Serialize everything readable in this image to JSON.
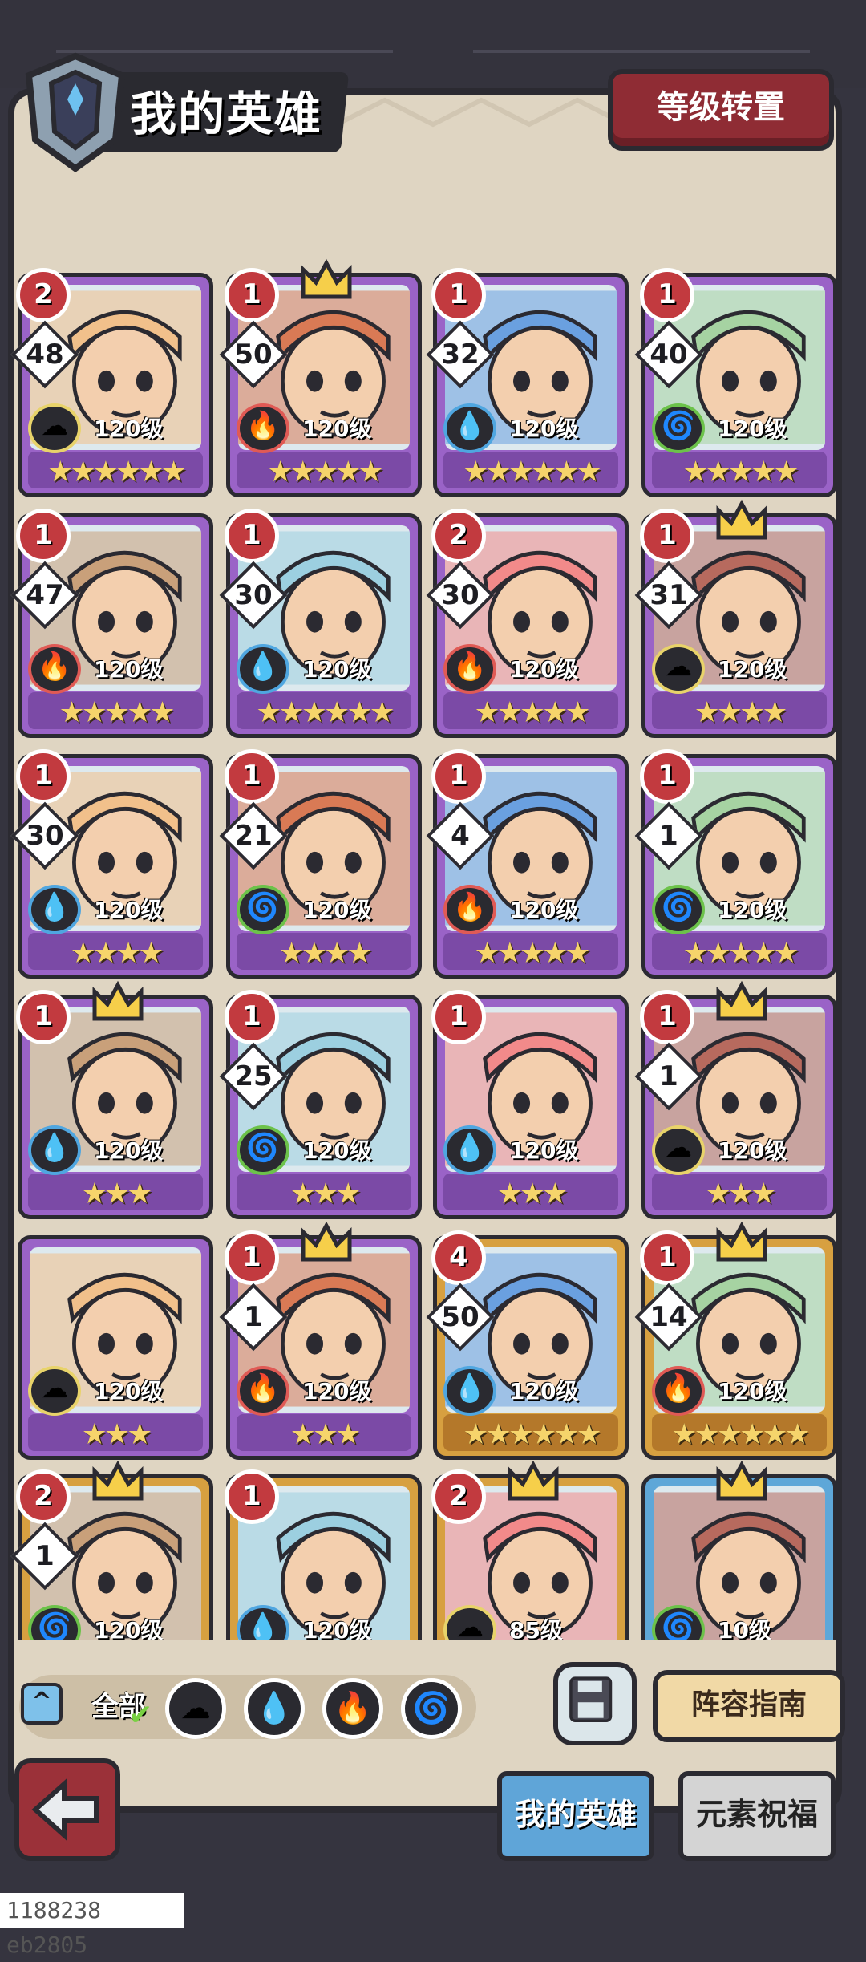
{
  "header": {
    "title": "我的英雄",
    "level_transfer_label": "等级转置"
  },
  "heroes": [
    {
      "rank": "2",
      "level_badge": "48",
      "level": "120级",
      "element": "earth",
      "stars": "★★★★★★",
      "frame": "purple",
      "crown": false
    },
    {
      "rank": "1",
      "level_badge": "50",
      "level": "120级",
      "element": "fire",
      "stars": "★★★★★",
      "frame": "purple",
      "crown": true
    },
    {
      "rank": "1",
      "level_badge": "32",
      "level": "120级",
      "element": "water",
      "stars": "★★★★★★",
      "frame": "purple",
      "crown": false
    },
    {
      "rank": "1",
      "level_badge": "40",
      "level": "120级",
      "element": "wind",
      "stars": "★★★★★",
      "frame": "purple",
      "crown": false
    },
    {
      "rank": "1",
      "level_badge": "47",
      "level": "120级",
      "element": "fire",
      "stars": "★★★★★",
      "frame": "purple",
      "crown": false
    },
    {
      "rank": "1",
      "level_badge": "30",
      "level": "120级",
      "element": "water",
      "stars": "★★★★★★",
      "frame": "purple",
      "crown": false
    },
    {
      "rank": "2",
      "level_badge": "30",
      "level": "120级",
      "element": "fire",
      "stars": "★★★★★",
      "frame": "purple",
      "crown": false
    },
    {
      "rank": "1",
      "level_badge": "31",
      "level": "120级",
      "element": "earth",
      "stars": "★★★★",
      "frame": "purple",
      "crown": true
    },
    {
      "rank": "1",
      "level_badge": "30",
      "level": "120级",
      "element": "water",
      "stars": "★★★★",
      "frame": "purple",
      "crown": false
    },
    {
      "rank": "1",
      "level_badge": "21",
      "level": "120级",
      "element": "wind",
      "stars": "★★★★",
      "frame": "purple",
      "crown": false
    },
    {
      "rank": "1",
      "level_badge": "4",
      "level": "120级",
      "element": "fire",
      "stars": "★★★★★",
      "frame": "purple",
      "crown": false
    },
    {
      "rank": "1",
      "level_badge": "1",
      "level": "120级",
      "element": "wind",
      "stars": "★★★★★",
      "frame": "purple",
      "crown": false
    },
    {
      "rank": "1",
      "level_badge": "",
      "level": "120级",
      "element": "water",
      "stars": "★★★",
      "frame": "purple",
      "crown": true
    },
    {
      "rank": "1",
      "level_badge": "25",
      "level": "120级",
      "element": "wind",
      "stars": "★★★",
      "frame": "purple",
      "crown": false
    },
    {
      "rank": "1",
      "level_badge": "",
      "level": "120级",
      "element": "water",
      "stars": "★★★",
      "frame": "purple",
      "crown": false
    },
    {
      "rank": "1",
      "level_badge": "1",
      "level": "120级",
      "element": "earth",
      "stars": "★★★",
      "frame": "purple",
      "crown": true
    },
    {
      "rank": "",
      "level_badge": "",
      "level": "120级",
      "element": "earth",
      "stars": "★★★",
      "frame": "purple",
      "crown": false
    },
    {
      "rank": "1",
      "level_badge": "1",
      "level": "120级",
      "element": "fire",
      "stars": "★★★",
      "frame": "purple",
      "crown": true
    },
    {
      "rank": "4",
      "level_badge": "50",
      "level": "120级",
      "element": "water",
      "stars": "★★★★★★",
      "frame": "gold",
      "crown": false
    },
    {
      "rank": "1",
      "level_badge": "14",
      "level": "120级",
      "element": "fire",
      "stars": "★★★★★★",
      "frame": "gold",
      "crown": true
    },
    {
      "rank": "2",
      "level_badge": "1",
      "level": "120级",
      "element": "wind",
      "stars": "",
      "frame": "gold",
      "crown": true
    },
    {
      "rank": "1",
      "level_badge": "",
      "level": "120级",
      "element": "water",
      "stars": "",
      "frame": "gold",
      "crown": false
    },
    {
      "rank": "2",
      "level_badge": "",
      "level": "85级",
      "element": "earth",
      "stars": "",
      "frame": "gold",
      "crown": true
    },
    {
      "rank": "",
      "level_badge": "",
      "level": "10级",
      "element": "wind",
      "stars": "",
      "frame": "blue",
      "crown": true
    }
  ],
  "filters": {
    "expand_symbol": "^",
    "all_label": "全部",
    "check_symbol": "✔",
    "elements": [
      {
        "name": "earth",
        "glyph": "☁"
      },
      {
        "name": "water",
        "glyph": "💧"
      },
      {
        "name": "fire",
        "glyph": "🔥"
      },
      {
        "name": "wind",
        "glyph": "🌀"
      }
    ]
  },
  "bottom": {
    "lineup_guide_label": "阵容指南",
    "tab_my_heroes": "我的英雄",
    "tab_element_blessing": "元素祝福",
    "footer_id": "1188238 eb2805"
  },
  "colors": {
    "earth": "#e8d36a",
    "water": "#4fa6e0",
    "fire": "#e05a55",
    "wind": "#6cc24a",
    "panel": "#dfd5c2",
    "frame_purple": "#9a63c7",
    "frame_gold": "#d7a040"
  }
}
